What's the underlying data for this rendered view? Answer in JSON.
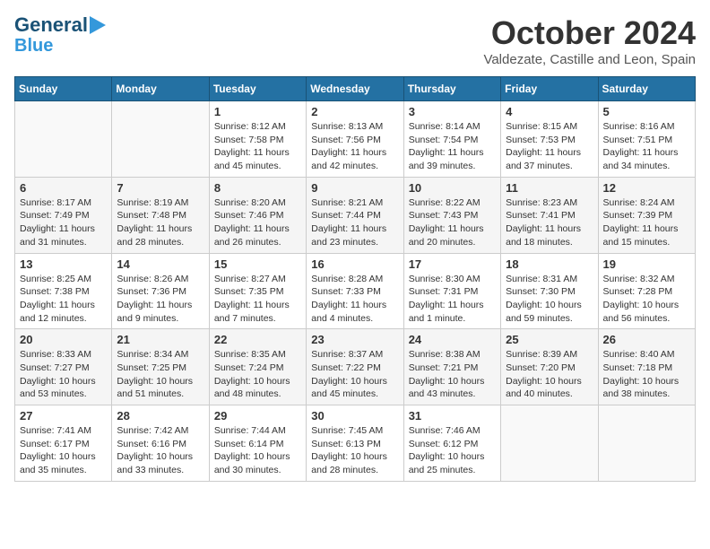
{
  "header": {
    "logo_line1": "General",
    "logo_line2": "Blue",
    "title": "October 2024",
    "subtitle": "Valdezate, Castille and Leon, Spain"
  },
  "calendar": {
    "columns": [
      "Sunday",
      "Monday",
      "Tuesday",
      "Wednesday",
      "Thursday",
      "Friday",
      "Saturday"
    ],
    "rows": [
      [
        {
          "day": "",
          "content": ""
        },
        {
          "day": "",
          "content": ""
        },
        {
          "day": "1",
          "content": "Sunrise: 8:12 AM\nSunset: 7:58 PM\nDaylight: 11 hours and 45 minutes."
        },
        {
          "day": "2",
          "content": "Sunrise: 8:13 AM\nSunset: 7:56 PM\nDaylight: 11 hours and 42 minutes."
        },
        {
          "day": "3",
          "content": "Sunrise: 8:14 AM\nSunset: 7:54 PM\nDaylight: 11 hours and 39 minutes."
        },
        {
          "day": "4",
          "content": "Sunrise: 8:15 AM\nSunset: 7:53 PM\nDaylight: 11 hours and 37 minutes."
        },
        {
          "day": "5",
          "content": "Sunrise: 8:16 AM\nSunset: 7:51 PM\nDaylight: 11 hours and 34 minutes."
        }
      ],
      [
        {
          "day": "6",
          "content": "Sunrise: 8:17 AM\nSunset: 7:49 PM\nDaylight: 11 hours and 31 minutes."
        },
        {
          "day": "7",
          "content": "Sunrise: 8:19 AM\nSunset: 7:48 PM\nDaylight: 11 hours and 28 minutes."
        },
        {
          "day": "8",
          "content": "Sunrise: 8:20 AM\nSunset: 7:46 PM\nDaylight: 11 hours and 26 minutes."
        },
        {
          "day": "9",
          "content": "Sunrise: 8:21 AM\nSunset: 7:44 PM\nDaylight: 11 hours and 23 minutes."
        },
        {
          "day": "10",
          "content": "Sunrise: 8:22 AM\nSunset: 7:43 PM\nDaylight: 11 hours and 20 minutes."
        },
        {
          "day": "11",
          "content": "Sunrise: 8:23 AM\nSunset: 7:41 PM\nDaylight: 11 hours and 18 minutes."
        },
        {
          "day": "12",
          "content": "Sunrise: 8:24 AM\nSunset: 7:39 PM\nDaylight: 11 hours and 15 minutes."
        }
      ],
      [
        {
          "day": "13",
          "content": "Sunrise: 8:25 AM\nSunset: 7:38 PM\nDaylight: 11 hours and 12 minutes."
        },
        {
          "day": "14",
          "content": "Sunrise: 8:26 AM\nSunset: 7:36 PM\nDaylight: 11 hours and 9 minutes."
        },
        {
          "day": "15",
          "content": "Sunrise: 8:27 AM\nSunset: 7:35 PM\nDaylight: 11 hours and 7 minutes."
        },
        {
          "day": "16",
          "content": "Sunrise: 8:28 AM\nSunset: 7:33 PM\nDaylight: 11 hours and 4 minutes."
        },
        {
          "day": "17",
          "content": "Sunrise: 8:30 AM\nSunset: 7:31 PM\nDaylight: 11 hours and 1 minute."
        },
        {
          "day": "18",
          "content": "Sunrise: 8:31 AM\nSunset: 7:30 PM\nDaylight: 10 hours and 59 minutes."
        },
        {
          "day": "19",
          "content": "Sunrise: 8:32 AM\nSunset: 7:28 PM\nDaylight: 10 hours and 56 minutes."
        }
      ],
      [
        {
          "day": "20",
          "content": "Sunrise: 8:33 AM\nSunset: 7:27 PM\nDaylight: 10 hours and 53 minutes."
        },
        {
          "day": "21",
          "content": "Sunrise: 8:34 AM\nSunset: 7:25 PM\nDaylight: 10 hours and 51 minutes."
        },
        {
          "day": "22",
          "content": "Sunrise: 8:35 AM\nSunset: 7:24 PM\nDaylight: 10 hours and 48 minutes."
        },
        {
          "day": "23",
          "content": "Sunrise: 8:37 AM\nSunset: 7:22 PM\nDaylight: 10 hours and 45 minutes."
        },
        {
          "day": "24",
          "content": "Sunrise: 8:38 AM\nSunset: 7:21 PM\nDaylight: 10 hours and 43 minutes."
        },
        {
          "day": "25",
          "content": "Sunrise: 8:39 AM\nSunset: 7:20 PM\nDaylight: 10 hours and 40 minutes."
        },
        {
          "day": "26",
          "content": "Sunrise: 8:40 AM\nSunset: 7:18 PM\nDaylight: 10 hours and 38 minutes."
        }
      ],
      [
        {
          "day": "27",
          "content": "Sunrise: 7:41 AM\nSunset: 6:17 PM\nDaylight: 10 hours and 35 minutes."
        },
        {
          "day": "28",
          "content": "Sunrise: 7:42 AM\nSunset: 6:16 PM\nDaylight: 10 hours and 33 minutes."
        },
        {
          "day": "29",
          "content": "Sunrise: 7:44 AM\nSunset: 6:14 PM\nDaylight: 10 hours and 30 minutes."
        },
        {
          "day": "30",
          "content": "Sunrise: 7:45 AM\nSunset: 6:13 PM\nDaylight: 10 hours and 28 minutes."
        },
        {
          "day": "31",
          "content": "Sunrise: 7:46 AM\nSunset: 6:12 PM\nDaylight: 10 hours and 25 minutes."
        },
        {
          "day": "",
          "content": ""
        },
        {
          "day": "",
          "content": ""
        }
      ]
    ]
  }
}
